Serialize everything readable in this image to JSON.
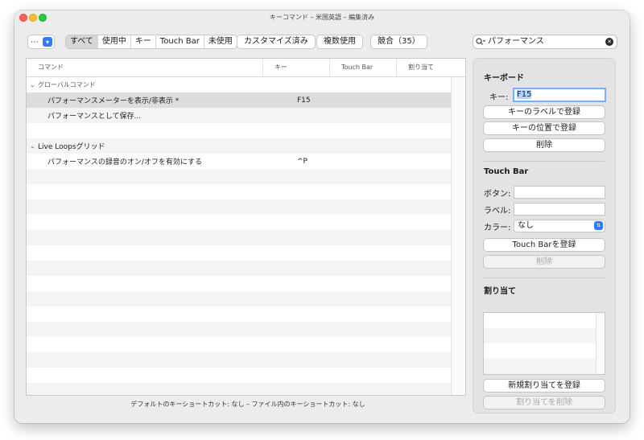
{
  "window": {
    "title": "キーコマンド – 米国英語 – 編集済み"
  },
  "toolbar": {
    "options_glyph": "⋯",
    "segments": [
      "すべて",
      "使用中",
      "キー",
      "Touch Bar",
      "未使用"
    ],
    "active_segment": "すべて",
    "customized_label": "カスタマイズ済み",
    "multiple_label": "複数使用",
    "conflicts_label": "競合（35）",
    "search_value": "パフォーマンス"
  },
  "table": {
    "headers": {
      "command": "コマンド",
      "key": "キー",
      "touchbar": "Touch Bar",
      "assign": "割り当て"
    },
    "group1": "グローバルコマンド",
    "row1": {
      "command": "パフォーマンスメーターを表示/非表示 *",
      "key": "F15"
    },
    "row2": {
      "command": "パフォーマンスとして保存...",
      "key": ""
    },
    "group2": "Live Loopsグリッド",
    "row3": {
      "command": "パフォーマンスの録音のオン/オフを有効にする",
      "key": "^P"
    }
  },
  "status_bar": "デフォルトのキーショートカット: なし – ファイル内のキーショートカット: なし",
  "inspector": {
    "keyboard": {
      "title": "キーボード",
      "key_label": "キー:",
      "key_value": "F15",
      "assign_by_label": "キーのラベルで登録",
      "assign_by_position": "キーの位置で登録",
      "delete": "削除"
    },
    "touchbar": {
      "title": "Touch Bar",
      "button_label": "ボタン:",
      "label_label": "ラベル:",
      "color_label": "カラー:",
      "color_value": "なし",
      "assign": "Touch Barを登録",
      "delete": "削除"
    },
    "assignments": {
      "title": "割り当て",
      "new": "新規割り当てを登録",
      "delete": "割り当てを削除"
    }
  },
  "colors": {
    "accent": "#2f7cf6",
    "selection": "#dcdcdc"
  }
}
